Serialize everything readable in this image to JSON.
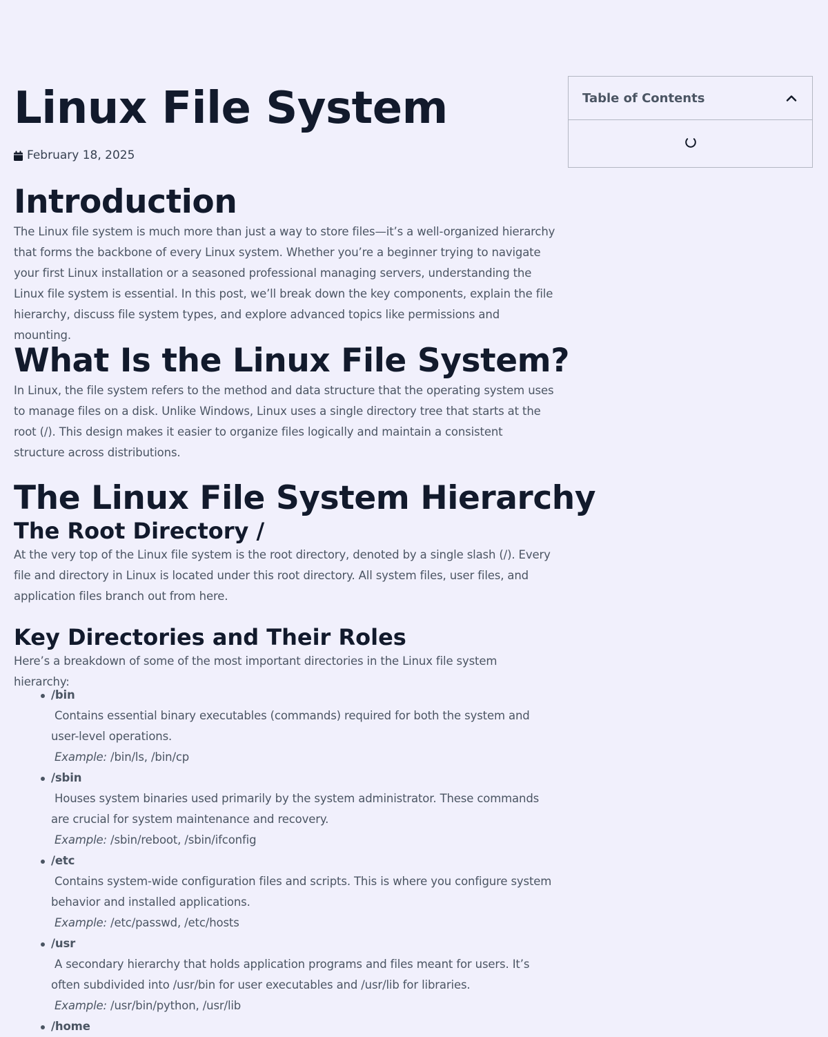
{
  "post": {
    "title": "Linux File System",
    "date": "February 18, 2025"
  },
  "toc": {
    "title": "Table of Contents"
  },
  "sections": {
    "intro_heading": "Introduction",
    "intro_text": "The Linux file system is much more than just a way to store files—it’s a well-organized hierarchy that forms the backbone of every Linux system. Whether you’re a beginner trying to navigate your first Linux installation or a seasoned professional managing servers, understanding the Linux file system is essential. In this post, we’ll break down the key components, explain the file hierarchy, discuss file system types, and explore advanced topics like permissions and mounting.",
    "what_heading": "What Is the Linux File System?",
    "what_text": "In Linux, the file system refers to the method and data structure that the operating system uses to manage files on a disk. Unlike Windows, Linux uses a single directory tree that starts at the root (/). This design makes it easier to organize files logically and maintain a consistent structure across distributions.",
    "hierarchy_heading": "The Linux File System Hierarchy",
    "root_heading": "The Root Directory /",
    "root_text": "At the very top of the Linux file system is the root directory, denoted by a single slash (/). Every file and directory in Linux is located under this root directory. All system files, user files, and application files branch out from here.",
    "key_heading": "Key Directories and Their Roles",
    "key_text": "Here’s a breakdown of some of the most important directories in the Linux file system hierarchy:"
  },
  "directories": [
    {
      "name": "/bin",
      "desc": "Contains essential binary executables (commands) required for both the system and user-level operations.",
      "example_label": "Example:",
      "example": " /bin/ls, /bin/cp"
    },
    {
      "name": "/sbin",
      "desc": "Houses system binaries used primarily by the system administrator. These commands are crucial for system maintenance and recovery.",
      "example_label": "Example:",
      "example": " /sbin/reboot, /sbin/ifconfig"
    },
    {
      "name": "/etc",
      "desc": "Contains system-wide configuration files and scripts. This is where you configure system behavior and installed applications.",
      "example_label": "Example:",
      "example": " /etc/passwd, /etc/hosts"
    },
    {
      "name": "/usr",
      "desc": "A secondary hierarchy that holds application programs and files meant for users. It’s often subdivided into /usr/bin for user executables and /usr/lib for libraries.",
      "example_label": "Example:",
      "example": " /usr/bin/python, /usr/lib"
    },
    {
      "name": "/home",
      "desc": "",
      "example_label": "",
      "example": ""
    }
  ],
  "icons": {
    "date": "calendar-icon",
    "toc_toggle": "chevron-up-icon",
    "toc_loading": "spinner-icon"
  },
  "colors": {
    "background": "#f1f0fc",
    "heading": "#121a2c",
    "body_text": "#4b5563",
    "border": "#b3b7c2"
  }
}
